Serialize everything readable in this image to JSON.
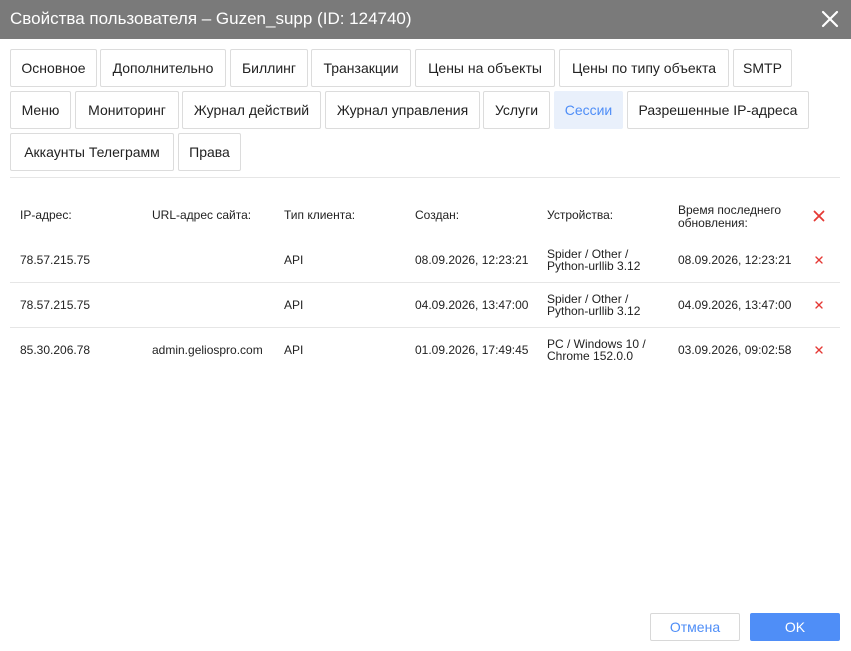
{
  "dialog": {
    "title": "Свойства пользователя – Guzen_supp (ID: 124740)"
  },
  "tabs": [
    {
      "label": "Основное"
    },
    {
      "label": "Дополнительно"
    },
    {
      "label": "Биллинг"
    },
    {
      "label": "Транзакции"
    },
    {
      "label": "Цены на объекты"
    },
    {
      "label": "Цены по типу объекта"
    },
    {
      "label": "SMTP"
    },
    {
      "label": "Меню"
    },
    {
      "label": "Мониторинг"
    },
    {
      "label": "Журнал действий"
    },
    {
      "label": "Журнал управления"
    },
    {
      "label": "Услуги"
    },
    {
      "label": "Сессии"
    },
    {
      "label": "Разрешенные IP-адреса"
    },
    {
      "label": "Аккаунты Телеграмм"
    },
    {
      "label": "Права"
    }
  ],
  "active_tab": "Сессии",
  "table": {
    "headers": {
      "ip": "IP-адрес:",
      "url": "URL-адрес сайта:",
      "client": "Тип клиента:",
      "created": "Создан:",
      "devices": "Устройства:",
      "last_update_1": "Время последнего",
      "last_update_2": "обновления:"
    },
    "rows": [
      {
        "ip": "78.57.215.75",
        "url": "",
        "client": "API",
        "created": "08.09.2026, 12:23:21",
        "device_1": "Spider / Other /",
        "device_2": "Python-urllib 3.12",
        "last_update": "08.09.2026, 12:23:21"
      },
      {
        "ip": "78.57.215.75",
        "url": "",
        "client": "API",
        "created": "04.09.2026, 13:47:00",
        "device_1": "Spider / Other /",
        "device_2": "Python-urllib 3.12",
        "last_update": "04.09.2026, 13:47:00"
      },
      {
        "ip": "85.30.206.78",
        "url": "admin.geliospro.com",
        "client": "API",
        "created": "01.09.2026, 17:49:45",
        "device_1": "PC / Windows 10 /",
        "device_2": "Chrome 152.0.0",
        "last_update": "03.09.2026, 09:02:58"
      }
    ]
  },
  "footer": {
    "cancel_label": "Отмена",
    "ok_label": "OK"
  },
  "icons": {
    "close": "close-icon",
    "delete": "delete-x-icon"
  },
  "colors": {
    "titlebar": "#7a7a7a",
    "accent": "#4f8ef7",
    "active_tab_bg": "#e9f0fb",
    "delete": "#e53935"
  }
}
